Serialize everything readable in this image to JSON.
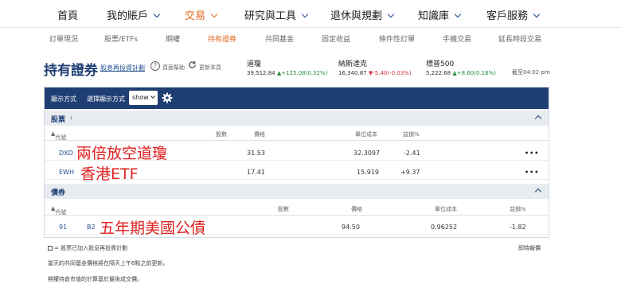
{
  "nav": {
    "items": [
      {
        "label": "首頁",
        "chevron": false,
        "active": false
      },
      {
        "label": "我的賬戶",
        "chevron": true,
        "active": false
      },
      {
        "label": "交易",
        "chevron": true,
        "active": true
      },
      {
        "label": "研究與工具",
        "chevron": true,
        "active": false
      },
      {
        "label": "退休與規劃",
        "chevron": true,
        "active": false
      },
      {
        "label": "知識庫",
        "chevron": true,
        "active": false
      },
      {
        "label": "客戶服務",
        "chevron": true,
        "active": false
      }
    ],
    "accent_color": "#e06a1e"
  },
  "subnav": {
    "items": [
      {
        "label": "訂單現況",
        "active": false
      },
      {
        "label": "股票/ETFs",
        "active": false
      },
      {
        "label": "期權",
        "active": false
      },
      {
        "label": "持有證券",
        "active": true
      },
      {
        "label": "共同基金",
        "active": false
      },
      {
        "label": "固定收益",
        "active": false
      },
      {
        "label": "條件性訂單",
        "active": false
      },
      {
        "label": "手機交易",
        "active": false
      },
      {
        "label": "延長時段交易",
        "active": false
      }
    ]
  },
  "header": {
    "title": "持有證券",
    "reinvest_link": "股息再投資計劃",
    "help_text": "頁面幫助",
    "refresh_text": "更新本頁",
    "as_of": "截至04:02 pm"
  },
  "indices": [
    {
      "name": "道瓊",
      "value": "39,512.84",
      "change": "▲+125.08(0.32%)",
      "direction": "up"
    },
    {
      "name": "納斯達克",
      "value": "16,340.87",
      "change": "▼-5.40(-0.03%)",
      "direction": "down"
    },
    {
      "name": "標普500",
      "value": "5,222.68",
      "change": "▲+8.60(0.16%)",
      "direction": "up"
    }
  ],
  "toolbar": {
    "display_label": "顯示方式",
    "select_label": "選擇顯示方式",
    "select_value": "show"
  },
  "stocks": {
    "title": "股票",
    "sort_mark": "↓",
    "columns": {
      "symbol": "代號",
      "qty": "股數",
      "price": "價格",
      "cost": "單位成本",
      "pl": "益損%"
    },
    "rows": [
      {
        "symbol": "DXD",
        "qty": "",
        "price": "31.53",
        "cost": "32.3097",
        "pl": "-2.41",
        "direction": "down",
        "more": "•••"
      },
      {
        "symbol": "EWH",
        "qty": "",
        "price": "17.41",
        "cost": "15.919",
        "pl": "+9.37",
        "direction": "up",
        "more": "•••"
      }
    ]
  },
  "bonds": {
    "title": "債券",
    "columns": {
      "symbol": "代號",
      "qty": "股數",
      "price": "價格",
      "cost": "單位成本",
      "pl": "益損%"
    },
    "rows": [
      {
        "symbol_start": "91",
        "symbol_end": "B2",
        "qty": "",
        "price": "94.50",
        "cost": "0.96252",
        "pl": "-1.82",
        "direction": "down"
      }
    ]
  },
  "annotations": {
    "dxd": "兩倍放空道瓊",
    "ewh": "香港ETF",
    "bond": "五年期美國公債"
  },
  "footer": {
    "legend": "= 股票已加入股息再投資計劃",
    "note1": "當天的共同基金價格將在隔天上午6點之前更新。",
    "note2": "期權持倉市值的計算基於最後成交價。",
    "realtime_link": "即時報價"
  }
}
